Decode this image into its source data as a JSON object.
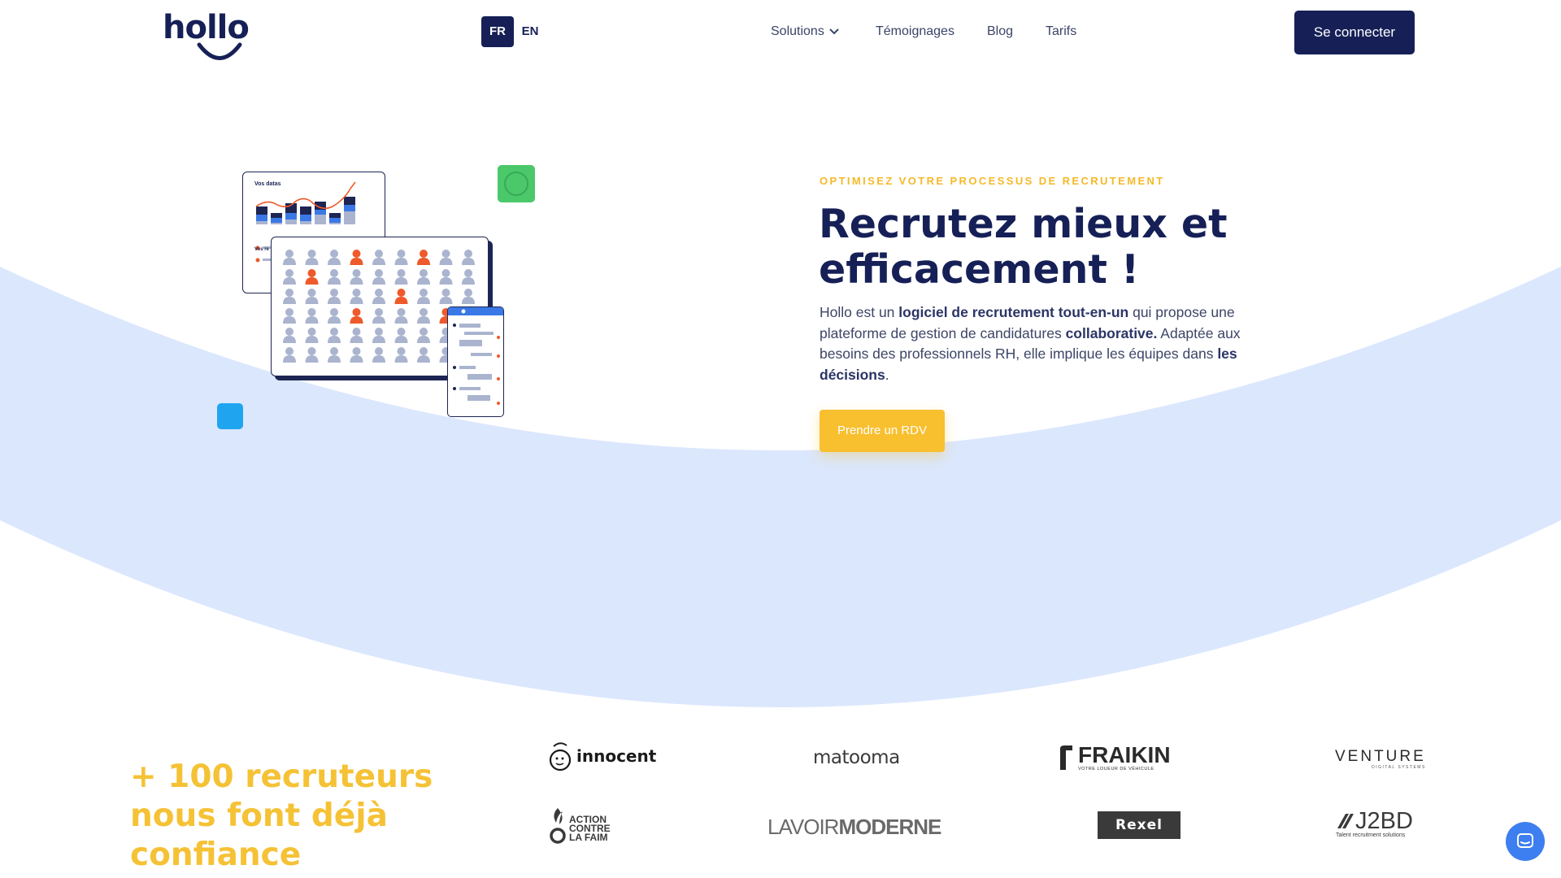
{
  "header": {
    "logo_text": "hollo",
    "lang_fr": "FR",
    "lang_en": "EN",
    "nav": {
      "solutions": "Solutions",
      "temoignages": "Témoignages",
      "blog": "Blog",
      "tarifs": "Tarifs"
    },
    "login_button": "Se connecter"
  },
  "illustration": {
    "chart_title": "Vos datas",
    "chart_sub": "Vos re"
  },
  "hero": {
    "eyebrow": "OPTIMISEZ VOTRE PROCESSUS DE RECRUTEMENT",
    "title_line1": "Recrutez mieux et",
    "title_line2": "efficacement !",
    "desc_1": "Hollo est un ",
    "desc_bold_1": "logiciel de recrutement tout-en-un",
    "desc_2": " qui propose une plateforme de gestion de candidatures ",
    "desc_bold_2": "collaborative.",
    "desc_3": " Adaptée aux besoins des professionnels RH, elle implique les équipes dans ",
    "desc_bold_3": "les décisions",
    "desc_4": ".",
    "cta_button": "Prendre un RDV"
  },
  "trust": {
    "heading": "+ 100 recruteurs nous font déjà confiance"
  },
  "clients": {
    "innocent": "innocent",
    "matooma": "matooma",
    "fraikin": "FRAIKIN",
    "fraikin_tag": "VOTRE LOUEUR DE VÉHICULE",
    "venture": "VENTURE",
    "venture_tag": "DIGITAL SYSTEMS",
    "acf_1": "ACTION",
    "acf_2": "CONTRE",
    "acf_3": "LA FAIM",
    "lavoir_1": "LAVOIR",
    "lavoir_2": "MODERNE",
    "rexel": "Rexel",
    "j2bd": "J2BD",
    "j2bd_tag": "Talent recruitment solutions"
  },
  "colors": {
    "navy": "#162057",
    "yellow": "#f8bf2f",
    "wave": "#dbe7fd",
    "green": "#4ac86a",
    "blue": "#1fa5f0",
    "orange": "#ee5a2b"
  },
  "icons": {
    "nav_solutions": "chevron-down-icon",
    "chat": "chat-bubble-icon"
  }
}
